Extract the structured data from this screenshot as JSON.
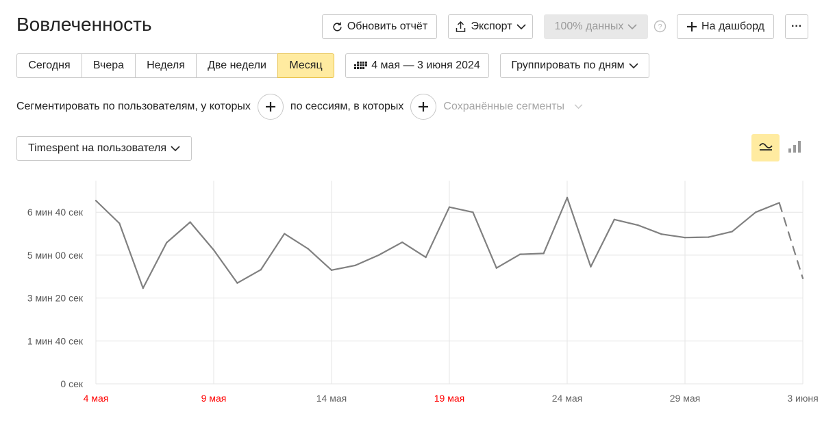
{
  "header": {
    "title": "Вовлеченность",
    "refresh_label": "Обновить отчёт",
    "export_label": "Экспорт",
    "data_sample_label": "100% данных",
    "dashboard_label": "На дашборд",
    "more_label": "···"
  },
  "periods": [
    {
      "label": "Сегодня",
      "active": false
    },
    {
      "label": "Вчера",
      "active": false
    },
    {
      "label": "Неделя",
      "active": false
    },
    {
      "label": "Две недели",
      "active": false
    },
    {
      "label": "Месяц",
      "active": true
    }
  ],
  "date_range": "4 мая — 3 июня 2024",
  "grouping_label": "Группировать по дням",
  "segment": {
    "users_text": "Сегментировать по пользователям, у которых",
    "sessions_text": "по сессиям, в которых",
    "saved_segments": "Сохранённые сегменты"
  },
  "metric_select": "Timespent на пользователя",
  "colors": {
    "accent": "#ffeba0",
    "line": "#808080",
    "weekend": "#ff0000",
    "grid": "#e5e5e5"
  },
  "chart_data": {
    "type": "line",
    "y_unit": "seconds",
    "ylim": [
      0,
      450
    ],
    "y_ticks": [
      {
        "value": 0,
        "label": "0 сек"
      },
      {
        "value": 100,
        "label": "1 мин 40 сек"
      },
      {
        "value": 200,
        "label": "3 мин 20 сек"
      },
      {
        "value": 300,
        "label": "5 мин 00 сек"
      },
      {
        "value": 400,
        "label": "6 мин 40 сек"
      }
    ],
    "x_ticks": [
      {
        "index": 0,
        "label": "4 мая",
        "weekend": true
      },
      {
        "index": 5,
        "label": "9 мая",
        "weekend": true
      },
      {
        "index": 10,
        "label": "14 мая",
        "weekend": false
      },
      {
        "index": 15,
        "label": "19 мая",
        "weekend": true
      },
      {
        "index": 20,
        "label": "24 мая",
        "weekend": false
      },
      {
        "index": 25,
        "label": "29 мая",
        "weekend": false
      },
      {
        "index": 30,
        "label": "3 июня",
        "weekend": false
      }
    ],
    "series": [
      {
        "dates": [
          "4 мая",
          "5 мая",
          "6 мая",
          "7 мая",
          "8 мая",
          "9 мая",
          "10 мая",
          "11 мая",
          "12 мая",
          "13 мая",
          "14 мая",
          "15 мая",
          "16 мая",
          "17 мая",
          "18 мая",
          "19 мая",
          "20 мая",
          "21 мая",
          "22 мая",
          "23 мая",
          "24 мая",
          "25 мая",
          "26 мая",
          "27 мая",
          "28 мая",
          "29 мая",
          "30 мая",
          "31 мая",
          "1 июня",
          "2 июня",
          "3 июня"
        ],
        "values": [
          427,
          374,
          223,
          329,
          377,
          312,
          235,
          266,
          350,
          315,
          265,
          276,
          300,
          330,
          295,
          412,
          400,
          270,
          302,
          304,
          434,
          273,
          383,
          370,
          349,
          341,
          342,
          355,
          400,
          422,
          246
        ],
        "incomplete_from_index": 29
      }
    ]
  }
}
